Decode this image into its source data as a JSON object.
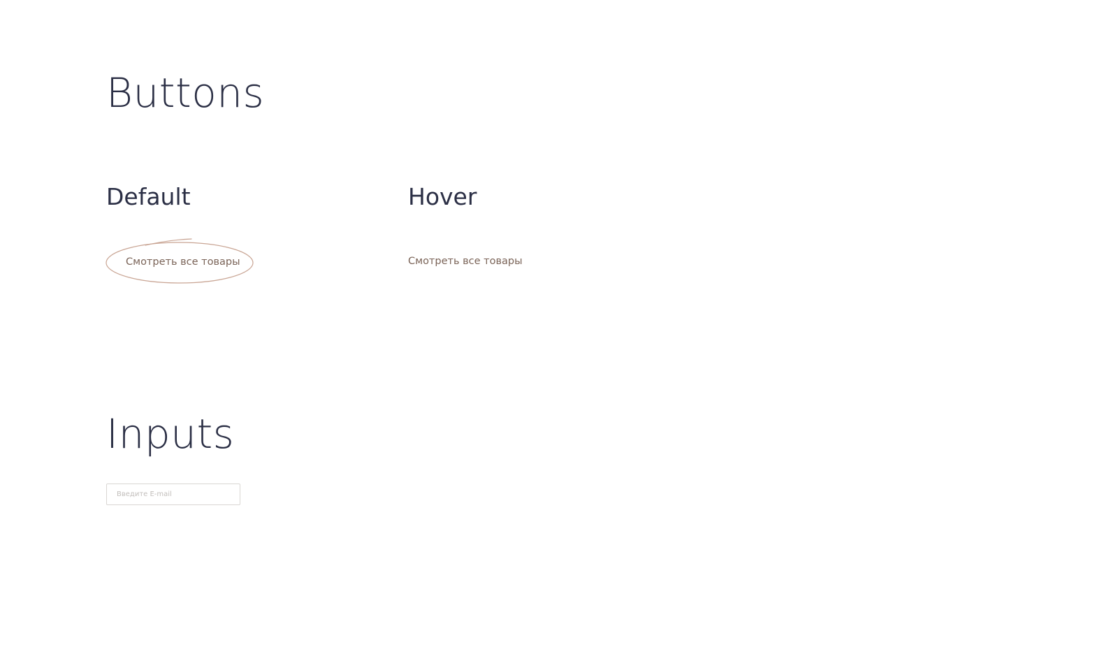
{
  "sections": {
    "buttons_title": "Buttons",
    "inputs_title": "Inputs"
  },
  "states": {
    "default_label": "Default",
    "hover_label": "Hover"
  },
  "buttons": {
    "default_text": "Смотреть все товары",
    "hover_text": "Смотреть все товары"
  },
  "inputs": {
    "email_placeholder": "Введите E-mail",
    "email_value": ""
  },
  "colors": {
    "heading": "#2b2f45",
    "button_text": "#7a6357",
    "button_outline": "#c9a594",
    "input_border": "#d9d6d3"
  },
  "icons": {
    "button_outline": "hand-drawn-ellipse"
  }
}
